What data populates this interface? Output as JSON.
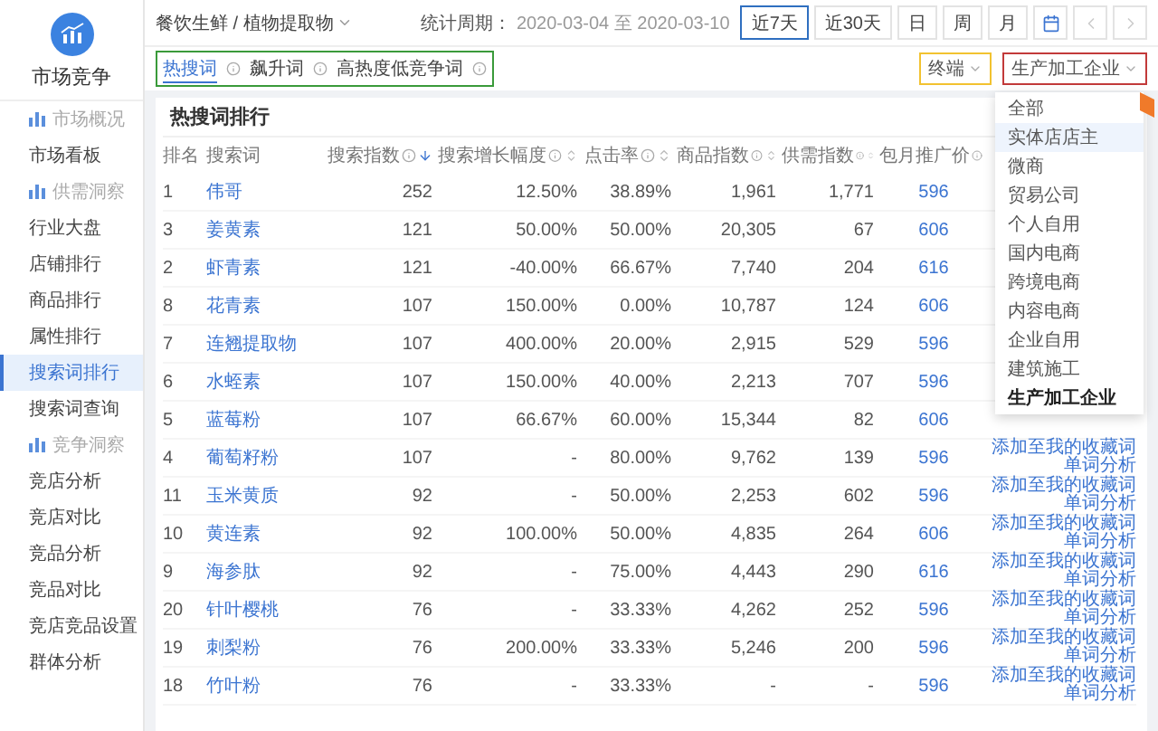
{
  "sidebar": {
    "title": "市场竞争",
    "sections": [
      {
        "label": "市场概况",
        "items": [
          {
            "label": "市场看板",
            "selected": false
          }
        ]
      },
      {
        "label": "供需洞察",
        "items": [
          {
            "label": "行业大盘",
            "selected": false
          },
          {
            "label": "店铺排行",
            "selected": false
          },
          {
            "label": "商品排行",
            "selected": false
          },
          {
            "label": "属性排行",
            "selected": false
          },
          {
            "label": "搜索词排行",
            "selected": true
          },
          {
            "label": "搜索词查询",
            "selected": false
          }
        ]
      },
      {
        "label": "竞争洞察",
        "items": [
          {
            "label": "竞店分析",
            "selected": false
          },
          {
            "label": "竞店对比",
            "selected": false
          },
          {
            "label": "竞品分析",
            "selected": false
          },
          {
            "label": "竞品对比",
            "selected": false
          },
          {
            "label": "竞店竞品设置",
            "selected": false
          },
          {
            "label": "群体分析",
            "selected": false
          }
        ]
      }
    ]
  },
  "toolbar": {
    "breadcrumb": "餐饮生鲜 / 植物提取物",
    "period_label": "统计周期：",
    "period": "2020-03-04 至 2020-03-10",
    "ranges": [
      {
        "label": "近7天",
        "selected": true
      },
      {
        "label": "近30天",
        "selected": false
      },
      {
        "label": "日",
        "selected": false
      },
      {
        "label": "周",
        "selected": false
      },
      {
        "label": "月",
        "selected": false
      }
    ]
  },
  "tabs": [
    {
      "label": "热搜词",
      "selected": true
    },
    {
      "label": "飙升词",
      "selected": false
    },
    {
      "label": "高热度低竞争词",
      "selected": false
    }
  ],
  "filters": [
    {
      "label": "终端",
      "color": "#f2c230"
    },
    {
      "label": "生产加工企业",
      "color": "#c23a3a"
    }
  ],
  "dropdown": {
    "options": [
      {
        "label": "全部",
        "selected": false,
        "hovered": false
      },
      {
        "label": "实体店店主",
        "selected": false,
        "hovered": true
      },
      {
        "label": "微商",
        "selected": false,
        "hovered": false
      },
      {
        "label": "贸易公司",
        "selected": false,
        "hovered": false
      },
      {
        "label": "个人自用",
        "selected": false,
        "hovered": false
      },
      {
        "label": "国内电商",
        "selected": false,
        "hovered": false
      },
      {
        "label": "跨境电商",
        "selected": false,
        "hovered": false
      },
      {
        "label": "内容电商",
        "selected": false,
        "hovered": false
      },
      {
        "label": "企业自用",
        "selected": false,
        "hovered": false
      },
      {
        "label": "建筑施工",
        "selected": false,
        "hovered": false
      },
      {
        "label": "生产加工企业",
        "selected": true,
        "hovered": false
      }
    ]
  },
  "table": {
    "title": "热搜词排行",
    "columns": [
      {
        "label": "排名"
      },
      {
        "label": "搜索词"
      },
      {
        "label": "搜索指数",
        "info": true,
        "sorted": true
      },
      {
        "label": "搜索增长幅度",
        "info": true,
        "sorted": false
      },
      {
        "label": "点击率",
        "info": true,
        "sorted": false
      },
      {
        "label": "商品指数",
        "info": true,
        "sorted": false
      },
      {
        "label": "供需指数",
        "info": true,
        "sorted": false
      },
      {
        "label": "包月推广价",
        "info": true
      }
    ],
    "rows": [
      {
        "rank": "1",
        "keyword": "伟哥",
        "search_index": "252",
        "growth": "12.50%",
        "click_rate": "38.89%",
        "product_index": "1,961",
        "supply_index": "1,771",
        "price": "596"
      },
      {
        "rank": "3",
        "keyword": "姜黄素",
        "search_index": "121",
        "growth": "50.00%",
        "click_rate": "50.00%",
        "product_index": "20,305",
        "supply_index": "67",
        "price": "606"
      },
      {
        "rank": "2",
        "keyword": "虾青素",
        "search_index": "121",
        "growth": "-40.00%",
        "click_rate": "66.67%",
        "product_index": "7,740",
        "supply_index": "204",
        "price": "616"
      },
      {
        "rank": "8",
        "keyword": "花青素",
        "search_index": "107",
        "growth": "150.00%",
        "click_rate": "0.00%",
        "product_index": "10,787",
        "supply_index": "124",
        "price": "606"
      },
      {
        "rank": "7",
        "keyword": "连翘提取物",
        "search_index": "107",
        "growth": "400.00%",
        "click_rate": "20.00%",
        "product_index": "2,915",
        "supply_index": "529",
        "price": "596"
      },
      {
        "rank": "6",
        "keyword": "水蛭素",
        "search_index": "107",
        "growth": "150.00%",
        "click_rate": "40.00%",
        "product_index": "2,213",
        "supply_index": "707",
        "price": "596"
      },
      {
        "rank": "5",
        "keyword": "蓝莓粉",
        "search_index": "107",
        "growth": "66.67%",
        "click_rate": "60.00%",
        "product_index": "15,344",
        "supply_index": "82",
        "price": "606"
      },
      {
        "rank": "4",
        "keyword": "葡萄籽粉",
        "search_index": "107",
        "growth": "-",
        "click_rate": "80.00%",
        "product_index": "9,762",
        "supply_index": "139",
        "price": "596",
        "actions": [
          {
            "kind": "collect",
            "label": "添加至我的收藏词"
          },
          {
            "kind": "analyze",
            "label": "单词分析"
          }
        ]
      },
      {
        "rank": "11",
        "keyword": "玉米黄质",
        "search_index": "92",
        "growth": "-",
        "click_rate": "50.00%",
        "product_index": "2,253",
        "supply_index": "602",
        "price": "596",
        "actions": [
          {
            "kind": "collect",
            "label": "添加至我的收藏词"
          },
          {
            "kind": "analyze",
            "label": "单词分析"
          }
        ]
      },
      {
        "rank": "10",
        "keyword": "黄连素",
        "search_index": "92",
        "growth": "100.00%",
        "click_rate": "50.00%",
        "product_index": "4,835",
        "supply_index": "264",
        "price": "606",
        "actions": [
          {
            "kind": "collect",
            "label": "添加至我的收藏词"
          },
          {
            "kind": "analyze",
            "label": "单词分析"
          }
        ]
      },
      {
        "rank": "9",
        "keyword": "海参肽",
        "search_index": "92",
        "growth": "-",
        "click_rate": "75.00%",
        "product_index": "4,443",
        "supply_index": "290",
        "price": "616",
        "actions": [
          {
            "kind": "collect",
            "label": "添加至我的收藏词"
          },
          {
            "kind": "analyze",
            "label": "单词分析"
          }
        ]
      },
      {
        "rank": "20",
        "keyword": "针叶樱桃",
        "search_index": "76",
        "growth": "-",
        "click_rate": "33.33%",
        "product_index": "4,262",
        "supply_index": "252",
        "price": "596",
        "actions": [
          {
            "kind": "collect",
            "label": "添加至我的收藏词"
          },
          {
            "kind": "analyze",
            "label": "单词分析"
          }
        ]
      },
      {
        "rank": "19",
        "keyword": "刺梨粉",
        "search_index": "76",
        "growth": "200.00%",
        "click_rate": "33.33%",
        "product_index": "5,246",
        "supply_index": "200",
        "price": "596",
        "actions": [
          {
            "kind": "collect",
            "label": "添加至我的收藏词"
          },
          {
            "kind": "analyze",
            "label": "单词分析"
          }
        ]
      },
      {
        "rank": "18",
        "keyword": "竹叶粉",
        "search_index": "76",
        "growth": "-",
        "click_rate": "33.33%",
        "product_index": "-",
        "supply_index": "-",
        "price": "596",
        "actions": [
          {
            "kind": "collect",
            "label": "添加至我的收藏词"
          },
          {
            "kind": "analyze",
            "label": "单词分析"
          }
        ]
      }
    ]
  }
}
